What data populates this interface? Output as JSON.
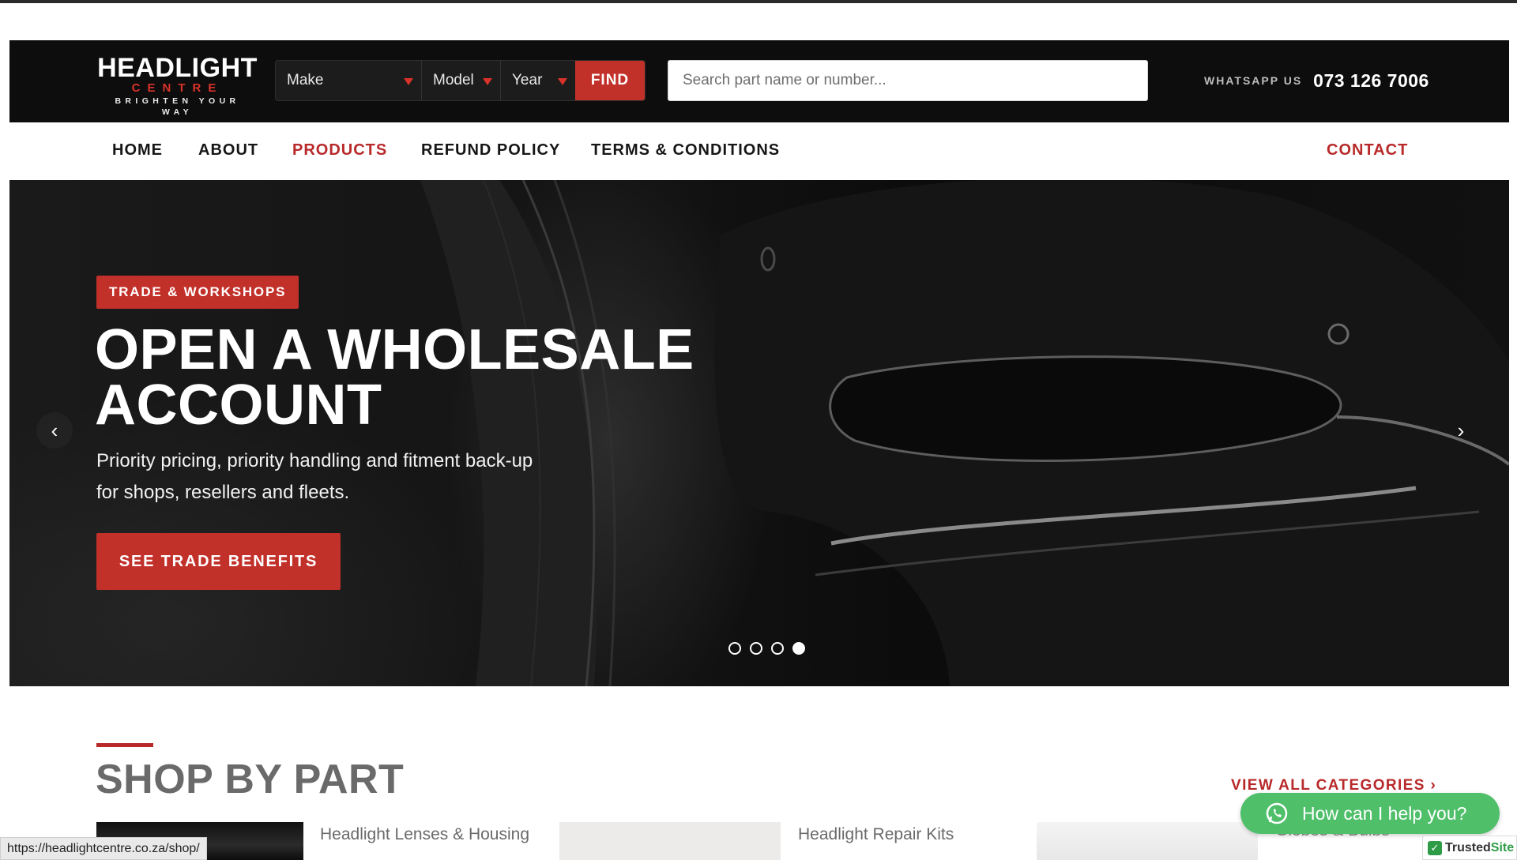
{
  "header": {
    "logo": {
      "name": "HEADLIGHT",
      "sub": "CENTRE",
      "tagline": "BRIGHTEN YOUR WAY"
    },
    "finder": {
      "make": "Make",
      "model": "Model",
      "year": "Year",
      "find_label": "FIND"
    },
    "search": {
      "placeholder": "Search part name or number..."
    },
    "whatsapp": {
      "label": "WHATSAPP US",
      "phone": "073 126 7006"
    }
  },
  "nav": {
    "items": [
      {
        "label": "HOME"
      },
      {
        "label": "ABOUT"
      },
      {
        "label": "PRODUCTS",
        "active": true
      },
      {
        "label": "REFUND POLICY"
      },
      {
        "label": "TERMS & CONDITIONS"
      }
    ],
    "contact_label": "CONTACT"
  },
  "hero": {
    "badge": "TRADE & WORKSHOPS",
    "title_line1": "OPEN A WHOLESALE",
    "title_line2": "ACCOUNT",
    "subtitle_line1": "Priority pricing, priority handling and fitment back-up",
    "subtitle_line2": "for shops, resellers and fleets.",
    "cta_label": "SEE TRADE BENEFITS",
    "prev_arrow": "‹",
    "next_arrow": "›",
    "slides_total": 4,
    "active_slide": 4
  },
  "shop_by_part": {
    "title": "SHOP BY PART",
    "view_all": "VIEW ALL CATEGORIES ›",
    "categories": [
      {
        "label": "Headlight Lenses & Housing"
      },
      {
        "label": "Headlight Repair Kits"
      },
      {
        "label": "Globes & Bulbs"
      }
    ]
  },
  "status_bar": {
    "url": "https://headlightcentre.co.za/shop/"
  },
  "chat_widget": {
    "label": "How can I help you?"
  },
  "trust_badge": {
    "check": "✓",
    "name_a": "Trusted",
    "name_b": "Site"
  },
  "colors": {
    "accent": "#c2302a",
    "header_bg": "#0d0d0d",
    "chat_green": "#4fbf6a"
  }
}
